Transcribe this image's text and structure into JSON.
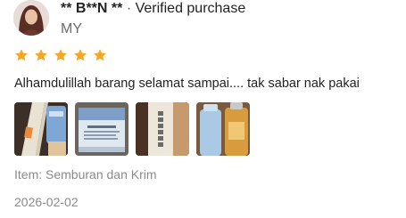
{
  "reviewer": {
    "name": "** B**N **",
    "separator": "·",
    "verified_label": "Verified purchase",
    "country": "MY"
  },
  "rating": {
    "value": 5,
    "max": 5,
    "star_color": "#f5a623",
    "star_icon": "star-icon"
  },
  "comment": "Alhamdulillah barang selamat sampai.... tak sabar nak pakai",
  "photos": [
    {
      "name": "review-photo-1"
    },
    {
      "name": "review-photo-2"
    },
    {
      "name": "review-photo-3"
    },
    {
      "name": "review-photo-4"
    }
  ],
  "item": {
    "prefix": "Item: ",
    "name": "Semburan dan Krim"
  },
  "date": "2026-02-02"
}
